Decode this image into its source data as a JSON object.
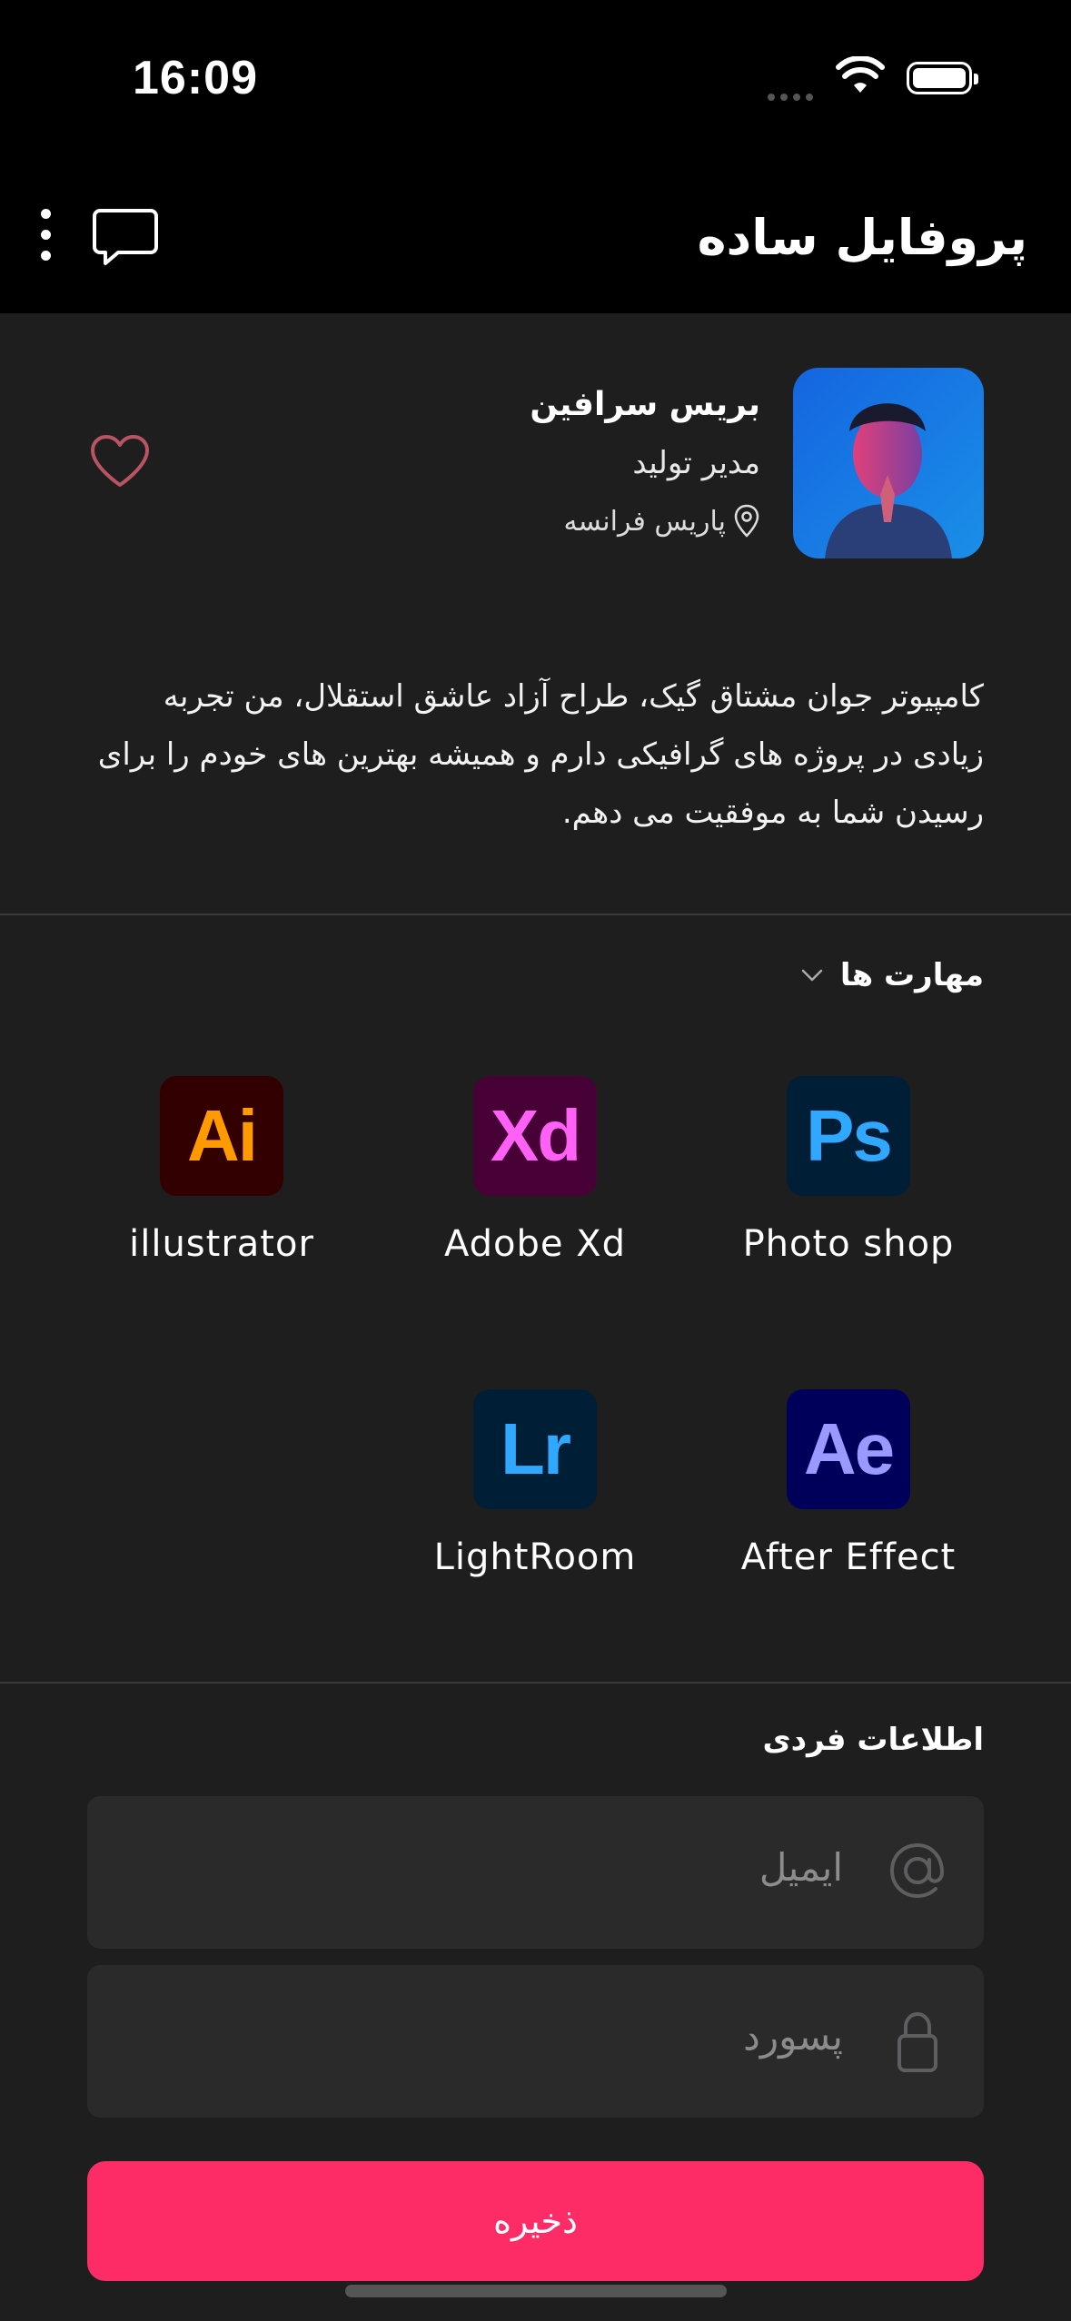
{
  "status_bar": {
    "time": "16:09"
  },
  "header": {
    "title": "پروفایل ساده"
  },
  "profile": {
    "name": "بریس سرافین",
    "role": "مدیر تولید",
    "location": "پاریس فرانسه",
    "bio": "کامپیوتر جوان مشتاق گیک، طراح آزاد عاشق استقلال، من تجربه زیادی در پروژه های گرافیکی دارم و همیشه بهترین های خودم را برای رسیدن شما به موفقیت می دهم."
  },
  "skills": {
    "title": "مهارت ها",
    "items": [
      {
        "abbr": "Ai",
        "label": "illustrator",
        "bg": "#330000",
        "fg": "#ff9a00"
      },
      {
        "abbr": "Xd",
        "label": "Adobe Xd",
        "bg": "#470137",
        "fg": "#ff61f6"
      },
      {
        "abbr": "Ps",
        "label": "Photo shop",
        "bg": "#001e36",
        "fg": "#31a8ff"
      },
      {
        "abbr": "Lr",
        "label": "LightRoom",
        "bg": "#001e36",
        "fg": "#31a8ff"
      },
      {
        "abbr": "Ae",
        "label": "After Effect",
        "bg": "#00005b",
        "fg": "#9999ff"
      }
    ]
  },
  "personal": {
    "title": "اطلاعات فردی",
    "email_placeholder": "ایمیل",
    "password_placeholder": "پسورد",
    "save_label": "ذخیره"
  },
  "colors": {
    "accent": "#fe2c66",
    "background": "#1e1e1f",
    "bar": "#000000"
  }
}
